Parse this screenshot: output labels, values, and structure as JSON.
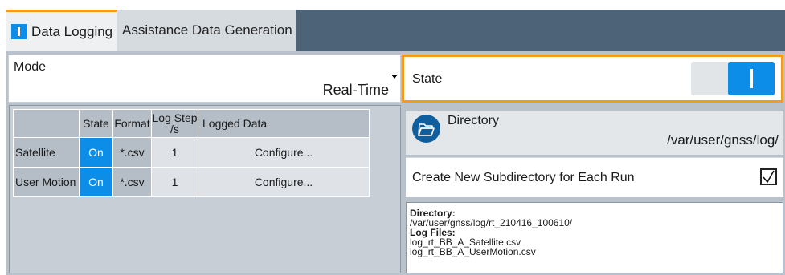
{
  "tabs": [
    {
      "label": "Data Logging",
      "active": true
    },
    {
      "label": "Assistance Data Generation",
      "active": false
    }
  ],
  "mode": {
    "label": "Mode",
    "value": "Real-Time"
  },
  "state": {
    "label": "State",
    "on": true
  },
  "table": {
    "headers": {
      "state": "State",
      "format": "Format",
      "log_step": "Log Step /s",
      "logged_data": "Logged Data"
    },
    "rows": [
      {
        "name": "Satellite",
        "state": "On",
        "format": "*.csv",
        "log_step": "1",
        "logged_data": "Configure..."
      },
      {
        "name": "User Motion",
        "state": "On",
        "format": "*.csv",
        "log_step": "1",
        "logged_data": "Configure..."
      }
    ]
  },
  "directory": {
    "label": "Directory",
    "value": "/var/user/gnss/log/"
  },
  "subdirectory": {
    "label": "Create New Subdirectory for Each Run",
    "checked": true
  },
  "info": {
    "directory_heading": "Directory:",
    "directory_path": "/var/user/gnss/log/rt_210416_100610/",
    "log_files_heading": "Log Files:",
    "files": [
      "log_rt_BB_A_Satellite.csv",
      "log_rt_BB_A_UserMotion.csv"
    ]
  },
  "colors": {
    "accent": "#f19b1f",
    "toggle_on": "#0c8ee8",
    "tab_strip": "#4d6478"
  },
  "icons": {
    "tab_marker": "toggle-marker-icon",
    "folder": "folder-open-icon",
    "dropdown": "caret-down-icon",
    "check": "checkmark-icon"
  }
}
